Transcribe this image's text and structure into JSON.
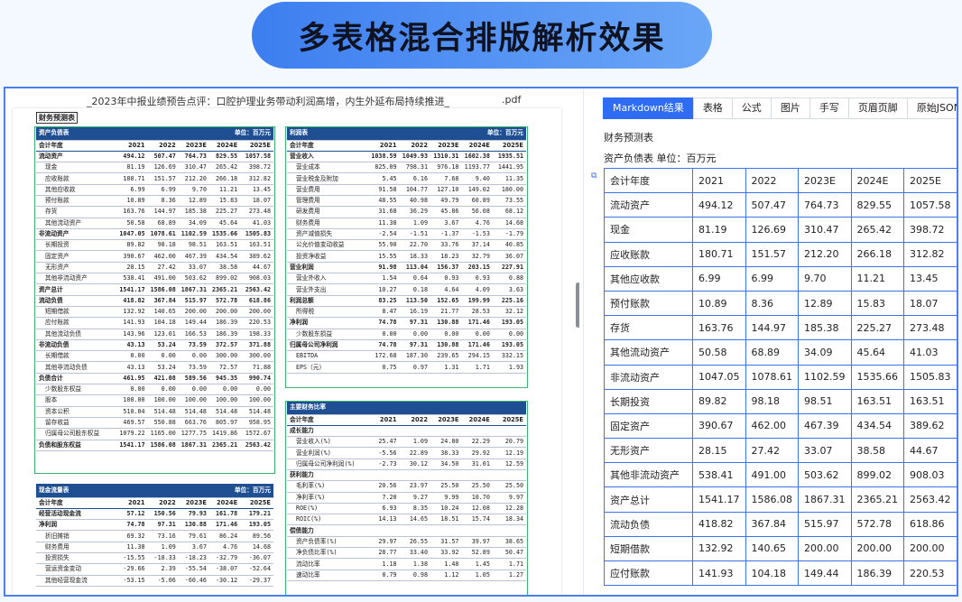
{
  "banner": {
    "title": "多表格混合排版解析效果"
  },
  "left": {
    "filename": "_2023年中报业绩预告点评：口腔护理业务带动利润高增，内生外延布局持续推进_",
    "ext": ".pdf",
    "section_title": "财务预测表",
    "balance": {
      "header": "资产负债表",
      "unit": "单位：百万元",
      "cols": [
        "会计年度",
        "2021",
        "2022",
        "2023E",
        "2024E",
        "2025E"
      ],
      "rows": [
        [
          "流动资产",
          "494.12",
          "507.47",
          "764.73",
          "829.55",
          "1057.58"
        ],
        [
          "现金",
          "81.19",
          "126.69",
          "310.47",
          "265.42",
          "398.72"
        ],
        [
          "应收账款",
          "180.71",
          "151.57",
          "212.20",
          "266.18",
          "312.82"
        ],
        [
          "其他应收款",
          "6.99",
          "6.99",
          "9.70",
          "11.21",
          "13.45"
        ],
        [
          "预付账款",
          "10.89",
          "8.36",
          "12.89",
          "15.83",
          "18.07"
        ],
        [
          "存货",
          "163.76",
          "144.97",
          "185.38",
          "225.27",
          "273.48"
        ],
        [
          "其他流动资产",
          "50.58",
          "68.89",
          "34.09",
          "45.64",
          "41.03"
        ],
        [
          "非流动资产",
          "1047.05",
          "1078.61",
          "1102.59",
          "1535.66",
          "1505.83"
        ],
        [
          "长期投资",
          "89.82",
          "98.18",
          "98.51",
          "163.51",
          "163.51"
        ],
        [
          "固定资产",
          "390.67",
          "462.00",
          "467.39",
          "434.54",
          "389.62"
        ],
        [
          "无形资产",
          "28.15",
          "27.42",
          "33.07",
          "38.58",
          "44.67"
        ],
        [
          "其他非流动资产",
          "538.41",
          "491.00",
          "503.62",
          "899.02",
          "908.03"
        ],
        [
          "资产总计",
          "1541.17",
          "1586.08",
          "1867.31",
          "2365.21",
          "2563.42"
        ],
        [
          "流动负债",
          "418.82",
          "367.84",
          "515.97",
          "572.78",
          "618.86"
        ],
        [
          "短期借款",
          "132.92",
          "140.65",
          "200.00",
          "200.00",
          "200.00"
        ],
        [
          "应付账款",
          "141.93",
          "104.18",
          "149.44",
          "186.39",
          "220.53"
        ],
        [
          "其他流动负债",
          "143.96",
          "123.01",
          "166.53",
          "186.39",
          "198.33"
        ],
        [
          "非流动负债",
          "43.13",
          "53.24",
          "73.59",
          "372.57",
          "371.88"
        ],
        [
          "长期借款",
          "0.00",
          "0.00",
          "0.00",
          "300.00",
          "300.00"
        ],
        [
          "其他非流动负债",
          "43.13",
          "53.24",
          "73.59",
          "72.57",
          "71.88"
        ],
        [
          "负债合计",
          "461.95",
          "421.08",
          "589.56",
          "945.35",
          "990.74"
        ],
        [
          "少数股东权益",
          "0.00",
          "0.00",
          "0.00",
          "0.00",
          "0.00"
        ],
        [
          "股本",
          "100.00",
          "100.00",
          "100.00",
          "100.00",
          "100.00"
        ],
        [
          "资本公积",
          "510.04",
          "514.48",
          "514.48",
          "514.48",
          "514.48"
        ],
        [
          "留存收益",
          "469.57",
          "550.88",
          "663.76",
          "805.97",
          "958.95"
        ],
        [
          "归属母公司股东权益",
          "1079.22",
          "1165.00",
          "1277.75",
          "1419.86",
          "1572.67"
        ],
        [
          "负债和股东权益",
          "1541.17",
          "1586.08",
          "1867.31",
          "2365.21",
          "2563.42"
        ]
      ]
    },
    "income": {
      "header": "利润表",
      "unit": "单位：百万元",
      "cols": [
        "会计年度",
        "2021",
        "2022",
        "2023E",
        "2024E",
        "2025E"
      ],
      "rows": [
        [
          "营业收入",
          "1038.59",
          "1049.93",
          "1310.31",
          "1602.38",
          "1935.51"
        ],
        [
          "营业成本",
          "825.09",
          "798.31",
          "976.18",
          "1193.77",
          "1441.95"
        ],
        [
          "营业税金及附加",
          "5.45",
          "6.16",
          "7.68",
          "9.40",
          "11.35"
        ],
        [
          "营业费用",
          "91.58",
          "104.77",
          "127.10",
          "149.02",
          "180.00"
        ],
        [
          "管理费用",
          "48.55",
          "40.98",
          "49.79",
          "60.89",
          "73.55"
        ],
        [
          "研发费用",
          "31.68",
          "36.29",
          "45.86",
          "56.08",
          "68.12"
        ],
        [
          "财务费用",
          "11.38",
          "1.09",
          "3.67",
          "4.76",
          "14.68"
        ],
        [
          "资产减值损失",
          "-2.54",
          "-1.51",
          "-1.37",
          "-1.53",
          "-1.79"
        ],
        [
          "公允价值变动收益",
          "55.90",
          "22.70",
          "33.76",
          "37.14",
          "40.85"
        ],
        [
          "投资净收益",
          "15.55",
          "18.33",
          "18.23",
          "32.79",
          "36.07"
        ],
        [
          "营业利润",
          "91.98",
          "113.04",
          "156.37",
          "203.15",
          "227.91"
        ],
        [
          "营业外收入",
          "1.54",
          "0.64",
          "0.93",
          "0.93",
          "0.88"
        ],
        [
          "营业外支出",
          "10.27",
          "0.18",
          "4.64",
          "4.09",
          "3.63"
        ],
        [
          "利润总额",
          "83.25",
          "113.50",
          "152.65",
          "199.99",
          "225.16"
        ],
        [
          "所得税",
          "8.47",
          "16.19",
          "21.77",
          "28.53",
          "32.12"
        ],
        [
          "净利润",
          "74.78",
          "97.31",
          "130.88",
          "171.46",
          "193.05"
        ],
        [
          "少数股东损益",
          "0.00",
          "0.00",
          "0.00",
          "0.00",
          "0.00"
        ],
        [
          "归属母公司净利润",
          "74.78",
          "97.31",
          "130.88",
          "171.46",
          "193.05"
        ],
        [
          "EBITDA",
          "172.68",
          "187.30",
          "239.65",
          "294.15",
          "332.15"
        ],
        [
          "EPS（元）",
          "0.75",
          "0.97",
          "1.31",
          "1.71",
          "1.93"
        ]
      ]
    },
    "ratios": {
      "header": "主要财务比率",
      "cols": [
        "会计年度",
        "2021",
        "2022",
        "2023E",
        "2024E",
        "2025E"
      ],
      "rows": [
        [
          "成长能力",
          "",
          "",
          "",
          "",
          ""
        ],
        [
          "营业收入(%)",
          "25.47",
          "1.09",
          "24.80",
          "22.29",
          "20.79"
        ],
        [
          "营业利润(%)",
          "-5.56",
          "22.89",
          "38.33",
          "29.92",
          "12.19"
        ],
        [
          "归属母公司净利润(%)",
          "-2.73",
          "30.12",
          "34.50",
          "31.01",
          "12.59"
        ],
        [
          "获利能力",
          "",
          "",
          "",
          "",
          ""
        ],
        [
          "毛利率(%)",
          "20.56",
          "23.97",
          "25.50",
          "25.50",
          "25.50"
        ],
        [
          "净利率(%)",
          "7.20",
          "9.27",
          "9.99",
          "10.70",
          "9.97"
        ],
        [
          "ROE(%)",
          "6.93",
          "8.35",
          "10.24",
          "12.08",
          "12.28"
        ],
        [
          "ROIC(%)",
          "14.13",
          "14.65",
          "18.51",
          "15.74",
          "18.34"
        ],
        [
          "偿债能力",
          "",
          "",
          "",
          "",
          ""
        ],
        [
          "资产负债率(%)",
          "29.97",
          "26.55",
          "31.57",
          "39.97",
          "38.65"
        ],
        [
          "净负债比率(%)",
          "28.77",
          "33.40",
          "33.92",
          "52.89",
          "50.47"
        ],
        [
          "流动比率",
          "1.18",
          "1.38",
          "1.48",
          "1.45",
          "1.71"
        ],
        [
          "速动比率",
          "0.79",
          "0.98",
          "1.12",
          "1.05",
          "1.27"
        ]
      ]
    },
    "cashflow": {
      "header": "现金流量表",
      "unit": "单位：百万元",
      "cols": [
        "会计年度",
        "2021",
        "2022",
        "2023E",
        "2024E",
        "2025E"
      ],
      "rows": [
        [
          "经营活动现金流",
          "57.12",
          "150.56",
          "79.93",
          "161.78",
          "179.21"
        ],
        [
          "净利润",
          "74.78",
          "97.31",
          "130.88",
          "171.46",
          "193.05"
        ],
        [
          "折旧摊销",
          "69.32",
          "73.16",
          "79.61",
          "86.24",
          "89.56"
        ],
        [
          "财务费用",
          "11.38",
          "1.09",
          "3.67",
          "4.76",
          "14.68"
        ],
        [
          "投资损失",
          "-15.55",
          "-18.33",
          "-18.23",
          "-32.79",
          "-36.07"
        ],
        [
          "营运资金变动",
          "-29.66",
          "2.39",
          "-55.54",
          "-38.07",
          "-52.64"
        ],
        [
          "其他经营现金流",
          "-53.15",
          "-5.06",
          "-60.46",
          "-30.12",
          "-29.37"
        ]
      ]
    }
  },
  "right": {
    "tabs": [
      "Markdown结果",
      "表格",
      "公式",
      "图片",
      "手写",
      "页眉页脚",
      "原始JSON"
    ],
    "heading": "财务预测表",
    "subheading": "资产负债表 单位：百万元",
    "table": [
      [
        "会计年度",
        "2021",
        "2022",
        "2023E",
        "2024E",
        "2025E"
      ],
      [
        "流动资产",
        "494.12",
        "507.47",
        "764.73",
        "829.55",
        "1057.58"
      ],
      [
        "现金",
        "81.19",
        "126.69",
        "310.47",
        "265.42",
        "398.72"
      ],
      [
        "应收账款",
        "180.71",
        "151.57",
        "212.20",
        "266.18",
        "312.82"
      ],
      [
        "其他应收款",
        "6.99",
        "6.99",
        "9.70",
        "11.21",
        "13.45"
      ],
      [
        "预付账款",
        "10.89",
        "8.36",
        "12.89",
        "15.83",
        "18.07"
      ],
      [
        "存货",
        "163.76",
        "144.97",
        "185.38",
        "225.27",
        "273.48"
      ],
      [
        "其他流动资产",
        "50.58",
        "68.89",
        "34.09",
        "45.64",
        "41.03"
      ],
      [
        "非流动资产",
        "1047.05",
        "1078.61",
        "1102.59",
        "1535.66",
        "1505.83"
      ],
      [
        "长期投资",
        "89.82",
        "98.18",
        "98.51",
        "163.51",
        "163.51"
      ],
      [
        "固定资产",
        "390.67",
        "462.00",
        "467.39",
        "434.54",
        "389.62"
      ],
      [
        "无形资产",
        "28.15",
        "27.42",
        "33.07",
        "38.58",
        "44.67"
      ],
      [
        "其他非流动资产",
        "538.41",
        "491.00",
        "503.62",
        "899.02",
        "908.03"
      ],
      [
        "资产总计",
        "1541.17",
        "1586.08",
        "1867.31",
        "2365.21",
        "2563.42"
      ],
      [
        "流动负债",
        "418.82",
        "367.84",
        "515.97",
        "572.78",
        "618.86"
      ],
      [
        "短期借款",
        "132.92",
        "140.65",
        "200.00",
        "200.00",
        "200.00"
      ],
      [
        "应付账款",
        "141.93",
        "104.18",
        "149.44",
        "186.39",
        "220.53"
      ]
    ]
  }
}
